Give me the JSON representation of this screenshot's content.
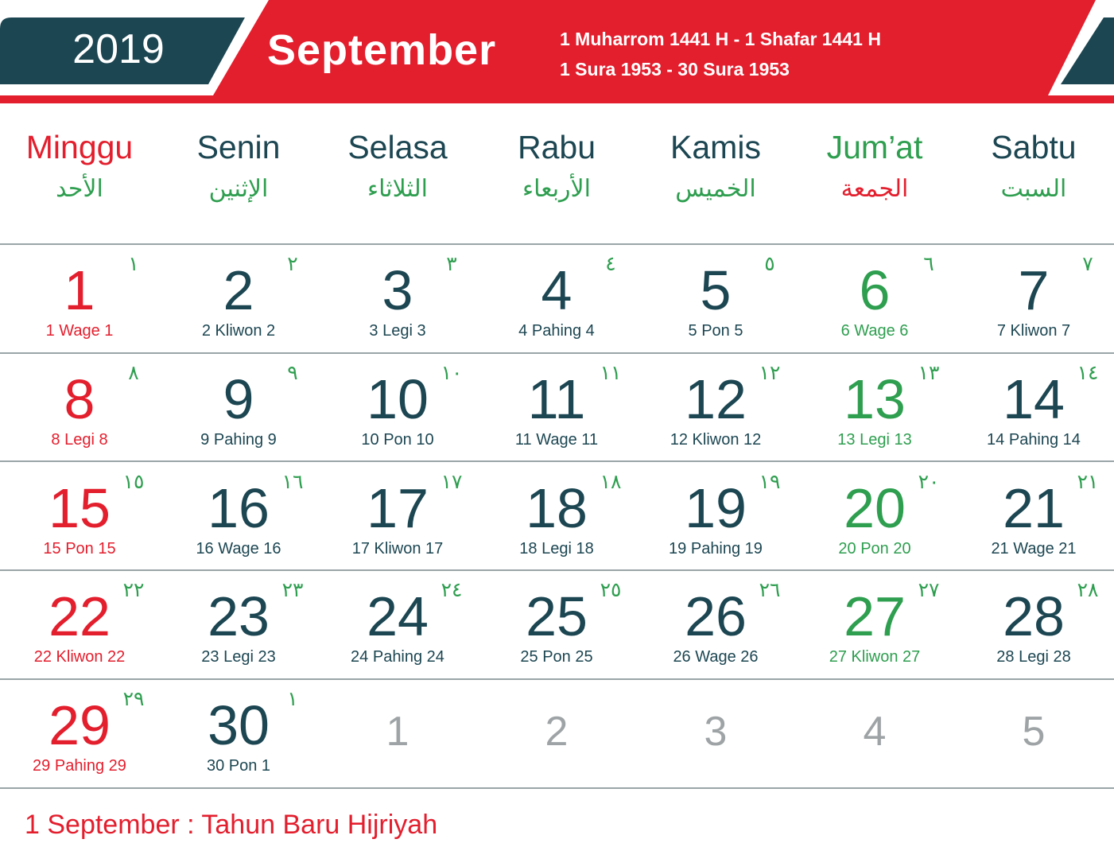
{
  "colors": {
    "red": "#e31e2d",
    "dark": "#1c4652",
    "green": "#2e9e4f",
    "gray": "#9ea3a5"
  },
  "header": {
    "year": "2019",
    "month": "September",
    "hijri_line1": "1 Muharrom 1441 H - 1 Shafar 1441 H",
    "hijri_line2": "1 Sura 1953 - 30 Sura 1953"
  },
  "days": [
    {
      "name": "Minggu",
      "arabic": "الأحد",
      "color": "red",
      "arabic_color": "green"
    },
    {
      "name": "Senin",
      "arabic": "الإثنين",
      "color": "dark",
      "arabic_color": "green"
    },
    {
      "name": "Selasa",
      "arabic": "الثلاثاء",
      "color": "dark",
      "arabic_color": "green"
    },
    {
      "name": "Rabu",
      "arabic": "الأربعاء",
      "color": "dark",
      "arabic_color": "green"
    },
    {
      "name": "Kamis",
      "arabic": "الخميس",
      "color": "dark",
      "arabic_color": "green"
    },
    {
      "name": "Jum’at",
      "arabic": "الجمعة",
      "color": "green",
      "arabic_color": "red"
    },
    {
      "name": "Sabtu",
      "arabic": "السبت",
      "color": "dark",
      "arabic_color": "green"
    }
  ],
  "weeks": [
    [
      {
        "num": "1",
        "hijri": "١",
        "jawa": "1 Wage 1",
        "color": "red"
      },
      {
        "num": "2",
        "hijri": "٢",
        "jawa": "2 Kliwon 2",
        "color": "dark"
      },
      {
        "num": "3",
        "hijri": "٣",
        "jawa": "3 Legi 3",
        "color": "dark"
      },
      {
        "num": "4",
        "hijri": "٤",
        "jawa": "4 Pahing 4",
        "color": "dark"
      },
      {
        "num": "5",
        "hijri": "٥",
        "jawa": "5 Pon 5",
        "color": "dark"
      },
      {
        "num": "6",
        "hijri": "٦",
        "jawa": "6 Wage 6",
        "color": "green"
      },
      {
        "num": "7",
        "hijri": "٧",
        "jawa": "7 Kliwon 7",
        "color": "dark"
      }
    ],
    [
      {
        "num": "8",
        "hijri": "٨",
        "jawa": "8 Legi 8",
        "color": "red"
      },
      {
        "num": "9",
        "hijri": "٩",
        "jawa": "9 Pahing 9",
        "color": "dark"
      },
      {
        "num": "10",
        "hijri": "١٠",
        "jawa": "10 Pon 10",
        "color": "dark"
      },
      {
        "num": "11",
        "hijri": "١١",
        "jawa": "11 Wage 11",
        "color": "dark"
      },
      {
        "num": "12",
        "hijri": "١٢",
        "jawa": "12 Kliwon 12",
        "color": "dark"
      },
      {
        "num": "13",
        "hijri": "١٣",
        "jawa": "13 Legi 13",
        "color": "green"
      },
      {
        "num": "14",
        "hijri": "١٤",
        "jawa": "14 Pahing 14",
        "color": "dark"
      }
    ],
    [
      {
        "num": "15",
        "hijri": "١٥",
        "jawa": "15 Pon 15",
        "color": "red"
      },
      {
        "num": "16",
        "hijri": "١٦",
        "jawa": "16 Wage 16",
        "color": "dark"
      },
      {
        "num": "17",
        "hijri": "١٧",
        "jawa": "17 Kliwon 17",
        "color": "dark"
      },
      {
        "num": "18",
        "hijri": "١٨",
        "jawa": "18 Legi 18",
        "color": "dark"
      },
      {
        "num": "19",
        "hijri": "١٩",
        "jawa": "19 Pahing 19",
        "color": "dark"
      },
      {
        "num": "20",
        "hijri": "٢٠",
        "jawa": "20 Pon 20",
        "color": "green"
      },
      {
        "num": "21",
        "hijri": "٢١",
        "jawa": "21 Wage 21",
        "color": "dark"
      }
    ],
    [
      {
        "num": "22",
        "hijri": "٢٢",
        "jawa": "22 Kliwon 22",
        "color": "red"
      },
      {
        "num": "23",
        "hijri": "٢٣",
        "jawa": "23 Legi 23",
        "color": "dark"
      },
      {
        "num": "24",
        "hijri": "٢٤",
        "jawa": "24 Pahing 24",
        "color": "dark"
      },
      {
        "num": "25",
        "hijri": "٢٥",
        "jawa": "25 Pon 25",
        "color": "dark"
      },
      {
        "num": "26",
        "hijri": "٢٦",
        "jawa": "26 Wage 26",
        "color": "dark"
      },
      {
        "num": "27",
        "hijri": "٢٧",
        "jawa": "27 Kliwon 27",
        "color": "green"
      },
      {
        "num": "28",
        "hijri": "٢٨",
        "jawa": "28 Legi 28",
        "color": "dark"
      }
    ],
    [
      {
        "num": "29",
        "hijri": "٢٩",
        "jawa": "29 Pahing 29",
        "color": "red"
      },
      {
        "num": "30",
        "hijri": "١",
        "jawa": "30 Pon 1",
        "color": "dark"
      },
      {
        "num": "1",
        "hijri": "",
        "jawa": "",
        "color": "gray"
      },
      {
        "num": "2",
        "hijri": "",
        "jawa": "",
        "color": "gray"
      },
      {
        "num": "3",
        "hijri": "",
        "jawa": "",
        "color": "gray"
      },
      {
        "num": "4",
        "hijri": "",
        "jawa": "",
        "color": "gray"
      },
      {
        "num": "5",
        "hijri": "",
        "jawa": "",
        "color": "gray"
      }
    ]
  ],
  "footer": {
    "note": "1 September : Tahun Baru Hijriyah"
  }
}
